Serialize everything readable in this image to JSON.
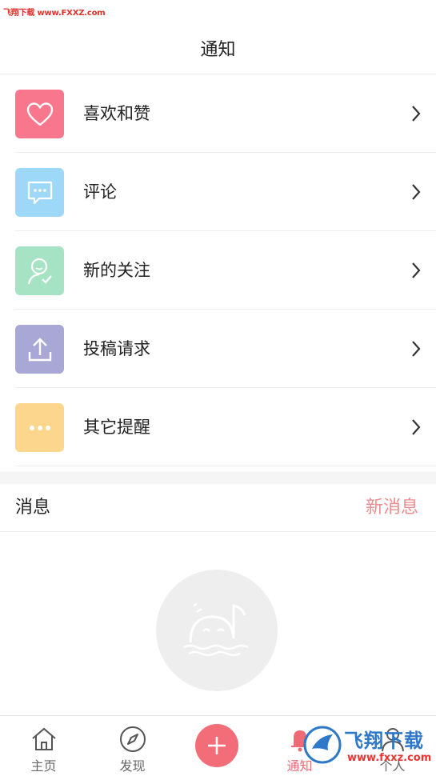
{
  "watermark_top": "飞翔下载 www.FXXZ.com",
  "header": {
    "title": "通知"
  },
  "colors": {
    "likes": "#f8778c",
    "comments": "#9ed8f8",
    "follows": "#a5e3c4",
    "submissions": "#a8a7d6",
    "others": "#fcd68d",
    "accent": "#f06a76"
  },
  "notifications": [
    {
      "label": "喜欢和赞",
      "icon": "heart-icon"
    },
    {
      "label": "评论",
      "icon": "comment-icon"
    },
    {
      "label": "新的关注",
      "icon": "user-check-icon"
    },
    {
      "label": "投稿请求",
      "icon": "upload-icon"
    },
    {
      "label": "其它提醒",
      "icon": "more-icon"
    }
  ],
  "messages": {
    "title": "消息",
    "new_message": "新消息"
  },
  "empty_state": {
    "icon": "whale-icon"
  },
  "tabbar": {
    "home": "主页",
    "discover": "发现",
    "notify": "通知",
    "me": "个人"
  },
  "bottom_watermark": {
    "text": "飞翔下载",
    "sub": "www.fxxz.com"
  }
}
